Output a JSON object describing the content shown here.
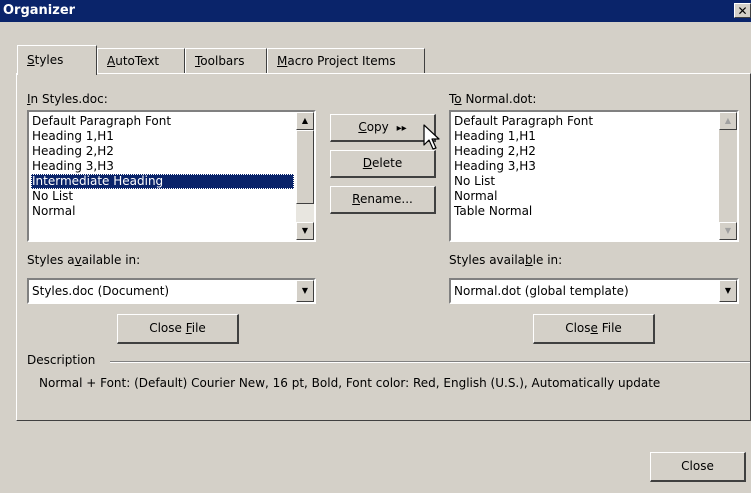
{
  "window": {
    "title": "Organizer",
    "close_glyph": "✕"
  },
  "tabs": [
    {
      "label_pre": "",
      "label_key": "S",
      "label_post": "tyles",
      "active": true
    },
    {
      "label_pre": "",
      "label_key": "A",
      "label_post": "utoText",
      "active": false
    },
    {
      "label_pre": "",
      "label_key": "T",
      "label_post": "oolbars",
      "active": false
    },
    {
      "label_pre": "",
      "label_key": "M",
      "label_post": "acro Project Items",
      "active": false
    }
  ],
  "left": {
    "list_label_pre": "",
    "list_label_key": "I",
    "list_label_post": "n Styles.doc:",
    "items": [
      "Default Paragraph Font",
      "Heading 1,H1",
      "Heading 2,H2",
      "Heading 3,H3",
      "Intermediate Heading",
      "No List",
      "Normal"
    ],
    "selected_index": 4,
    "available_label_pre": "Styles a",
    "available_label_key": "v",
    "available_label_post": "ailable in:",
    "available_value": "Styles.doc (Document)",
    "close_file_pre": "Close ",
    "close_file_key": "F",
    "close_file_post": "ile"
  },
  "right": {
    "list_label_pre": "T",
    "list_label_key": "o",
    "list_label_post": " Normal.dot:",
    "items": [
      "Default Paragraph Font",
      "Heading 1,H1",
      "Heading 2,H2",
      "Heading 3,H3",
      "No List",
      "Normal",
      "Table Normal"
    ],
    "available_label_pre": "Styles availa",
    "available_label_key": "b",
    "available_label_post": "le in:",
    "available_value": "Normal.dot (global template)",
    "close_file_pre": "Clos",
    "close_file_key": "e",
    "close_file_post": " File"
  },
  "actions": {
    "copy_key": "C",
    "copy_post": "opy",
    "copy_arrows": "▸▸",
    "delete_key": "D",
    "delete_post": "elete",
    "rename_key": "R",
    "rename_post": "ename..."
  },
  "description": {
    "label": "Description",
    "text": "Normal + Font: (Default) Courier New, 16 pt, Bold, Font color: Red, English (U.S.), Automatically update"
  },
  "footer": {
    "close_label": "Close"
  },
  "icons": {
    "scroll_up": "▲",
    "scroll_down": "▼",
    "dropdown": "▼"
  },
  "colors": {
    "title_bar": "#0a246a",
    "face": "#d4d0c8",
    "selection": "#0a246a"
  }
}
